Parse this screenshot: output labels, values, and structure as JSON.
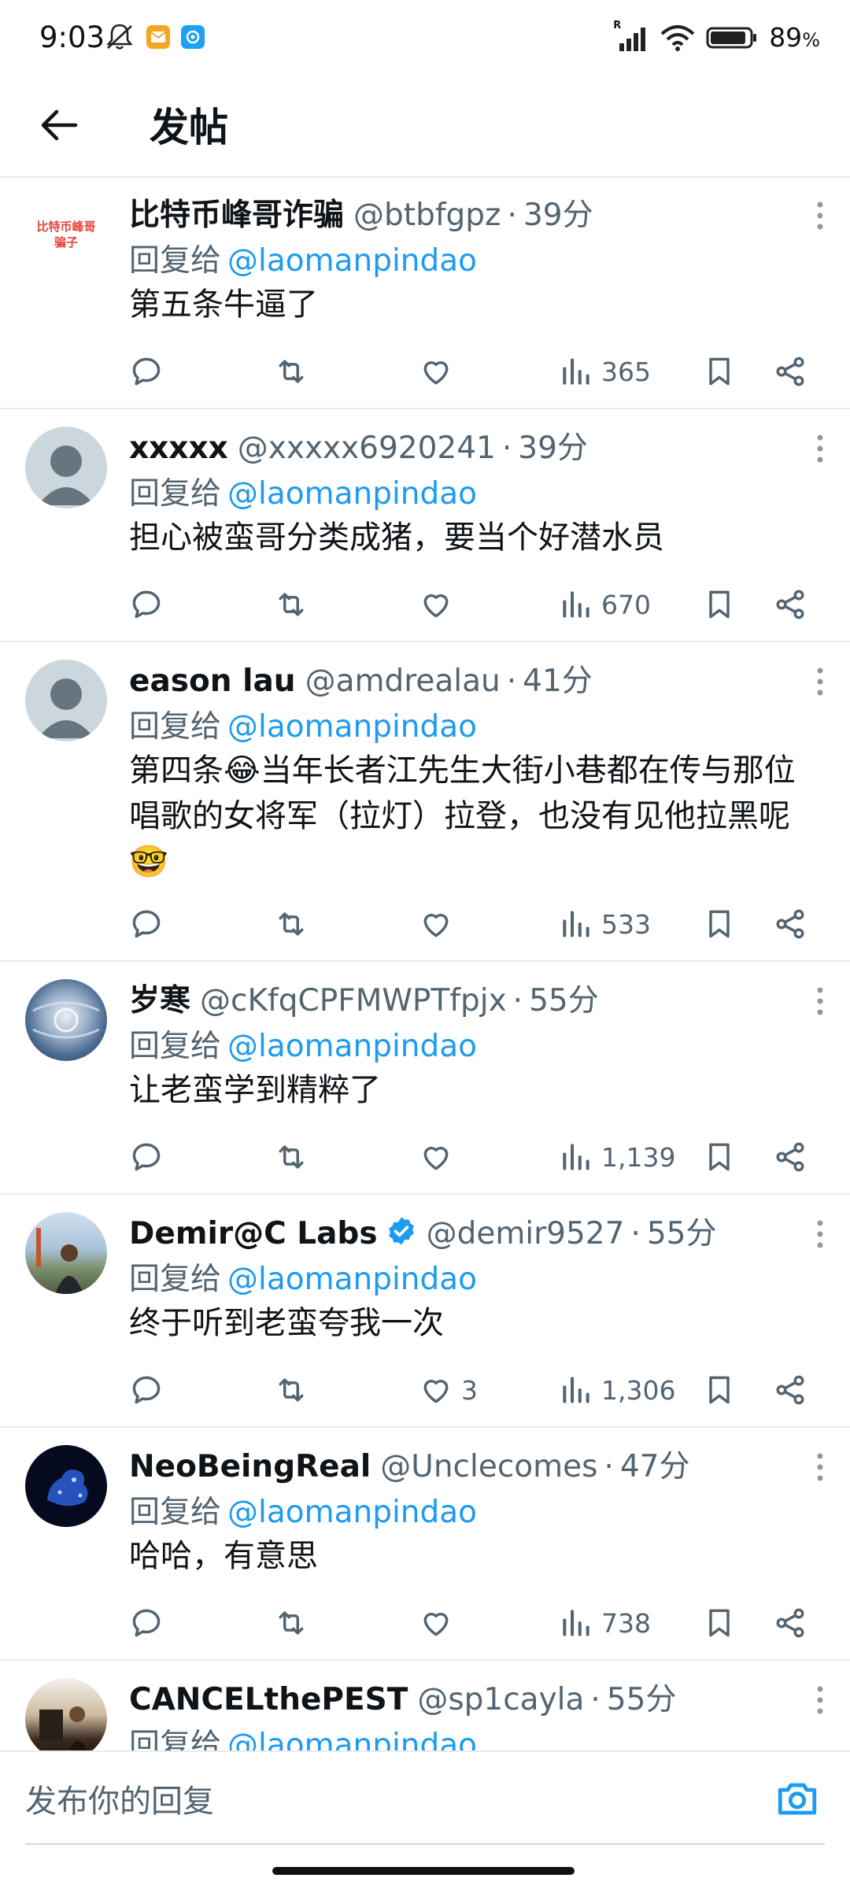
{
  "status": {
    "time": "9:03",
    "battery": "89",
    "battery_unit": "%",
    "net": "R"
  },
  "header": {
    "title": "发帖"
  },
  "replies": [
    {
      "name": "比特币峰哥诈骗",
      "handle": "@btbfgpz",
      "time": "39分",
      "reply_prefix": "回复给",
      "reply_to": "@laomanpindao",
      "text": "第五条牛逼了",
      "views": "365",
      "likes": "",
      "avatar_text": "比特币峰哥骗子",
      "verified": false
    },
    {
      "name": "xxxxx",
      "handle": "@xxxxx6920241",
      "time": "39分",
      "reply_prefix": "回复给",
      "reply_to": "@laomanpindao",
      "text": "担心被蛮哥分类成猪，要当个好潜水员",
      "views": "670",
      "likes": "",
      "verified": false
    },
    {
      "name": "eason lau",
      "handle": "@amdrealau",
      "time": "41分",
      "reply_prefix": "回复给",
      "reply_to": "@laomanpindao",
      "text": "第四条😂当年长者江先生大街小巷都在传与那位唱歌的女将军（拉灯）拉登，也没有见他拉黑呢🤓",
      "views": "533",
      "likes": "",
      "verified": false
    },
    {
      "name": "岁寒",
      "handle": "@cKfqCPFMWPTfpjx",
      "time": "55分",
      "reply_prefix": "回复给",
      "reply_to": "@laomanpindao",
      "text": "让老蛮学到精粹了",
      "views": "1,139",
      "likes": "",
      "verified": false
    },
    {
      "name": "Demir@C Labs",
      "handle": "@demir9527",
      "time": "55分",
      "reply_prefix": "回复给",
      "reply_to": "@laomanpindao",
      "text": "终于听到老蛮夸我一次",
      "views": "1,306",
      "likes": "3",
      "verified": true
    },
    {
      "name": "NeoBeingReal",
      "handle": "@Unclecomes",
      "time": "47分",
      "reply_prefix": "回复给",
      "reply_to": "@laomanpindao",
      "text": "哈哈，有意思",
      "views": "738",
      "likes": "",
      "verified": false
    },
    {
      "name": "CANCELthePEST",
      "handle": "@sp1cayla",
      "time": "55分",
      "reply_prefix": "回复给",
      "reply_to": "@laomanpindao",
      "text": "",
      "views": "",
      "likes": "",
      "verified": false
    }
  ],
  "composer": {
    "placeholder": "发布你的回复"
  },
  "colors": {
    "link": "#1d9bf0",
    "muted": "#536471",
    "verified": "#1d9bf0"
  },
  "icons": [
    "back-arrow-icon",
    "reply-icon",
    "retweet-icon",
    "like-icon",
    "views-icon",
    "bookmark-icon",
    "share-icon",
    "more-icon",
    "camera-icon",
    "verified-icon"
  ]
}
